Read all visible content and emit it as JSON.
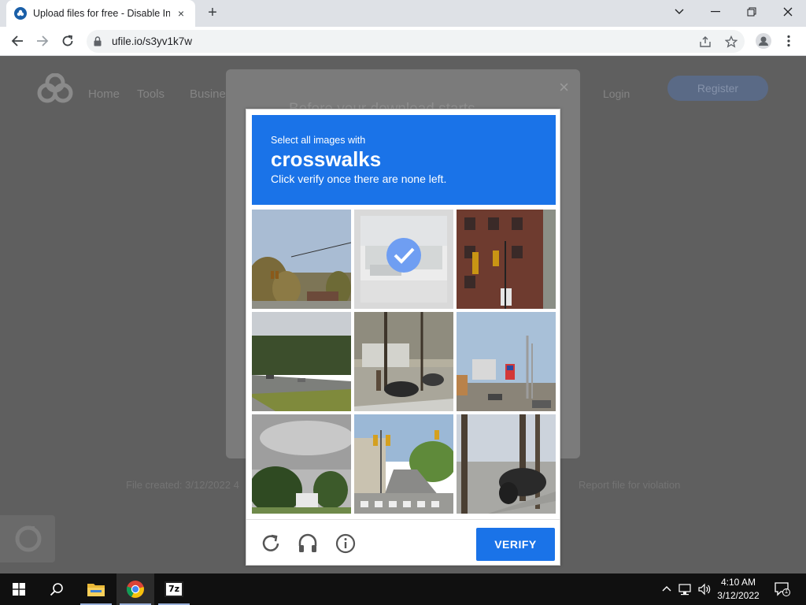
{
  "browser": {
    "tab_title": "Upload files for free - Disable Int",
    "tab_close": "×",
    "new_tab": "+",
    "url": "ufile.io/s3yv1k7w"
  },
  "page": {
    "nav": [
      "Home",
      "Tools",
      "Busine"
    ],
    "login": "Login",
    "register": "Register",
    "modal_heading": "Before your download starts",
    "modal_close": "×",
    "footer_left": "File created: 3/12/2022 4",
    "footer_right": "Report file for violation"
  },
  "captcha": {
    "instruction": "Select all images with",
    "keyword": "crosswalks",
    "hint": "Click verify once there are none left.",
    "verify_label": "VERIFY",
    "selected_tile": 2,
    "accent_color": "#1a73e8",
    "icons": [
      "reload-icon",
      "audio-challenge-icon",
      "info-icon"
    ]
  },
  "taskbar": {
    "time": "4:10 AM",
    "date": "3/12/2022",
    "notification_count": "1",
    "apps": [
      "file-explorer-icon",
      "chrome-icon",
      "7zip-icon"
    ],
    "app_7zip_label": "7z"
  }
}
